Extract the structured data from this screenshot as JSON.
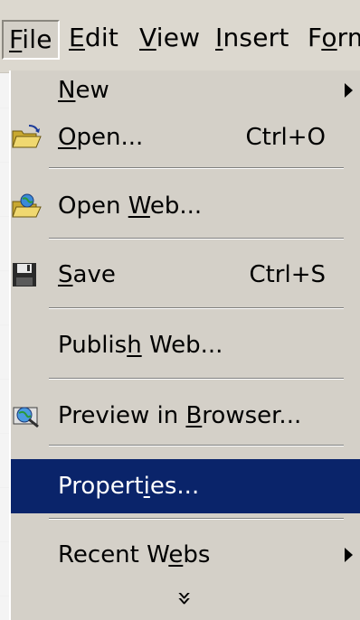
{
  "menubar": {
    "items": [
      {
        "pre": "",
        "accel": "F",
        "post": "ile"
      },
      {
        "pre": "",
        "accel": "E",
        "post": "dit"
      },
      {
        "pre": "",
        "accel": "V",
        "post": "iew"
      },
      {
        "pre": "",
        "accel": "I",
        "post": "nsert"
      },
      {
        "pre": "F",
        "accel": "o",
        "post": "rm"
      }
    ]
  },
  "file_menu": {
    "new": {
      "pre": "",
      "accel": "N",
      "post": "ew"
    },
    "open": {
      "pre": "",
      "accel": "O",
      "post": "pen...",
      "shortcut": "Ctrl+O",
      "icon": "open-folder-icon"
    },
    "open_web": {
      "pre": "Open ",
      "accel": "W",
      "post": "eb...",
      "icon": "open-web-folder-icon"
    },
    "save": {
      "pre": "",
      "accel": "S",
      "post": "ave",
      "shortcut": "Ctrl+S",
      "icon": "floppy-disk-icon"
    },
    "publish": {
      "pre": "Publis",
      "accel": "h",
      "post": " Web..."
    },
    "preview": {
      "pre": "Preview in ",
      "accel": "B",
      "post": "rowser...",
      "icon": "preview-browser-icon"
    },
    "properties": {
      "pre": "Propert",
      "accel": "i",
      "post": "es..."
    },
    "recent_webs": {
      "pre": "Recent W",
      "accel": "e",
      "post": "bs"
    },
    "expand_glyph": "»"
  },
  "colors": {
    "menu_bg": "#d4d0c8",
    "highlight": "#0a246a",
    "highlight_text": "#ffffff"
  }
}
